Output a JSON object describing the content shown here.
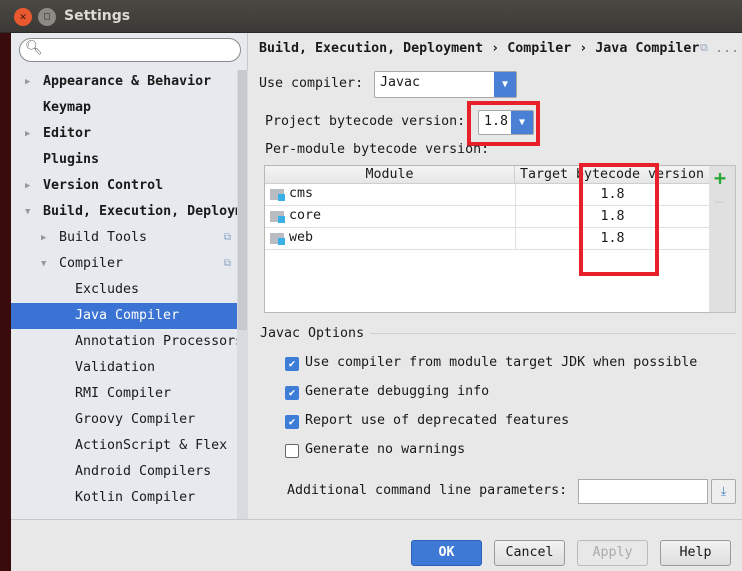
{
  "window": {
    "title": "Settings"
  },
  "search": {
    "placeholder": ""
  },
  "sidebar": {
    "items": [
      {
        "label": "Appearance & Behavior",
        "bold": true,
        "expandable": true
      },
      {
        "label": "Keymap",
        "bold": true
      },
      {
        "label": "Editor",
        "bold": true,
        "expandable": true
      },
      {
        "label": "Plugins",
        "bold": true
      },
      {
        "label": "Version Control",
        "bold": true,
        "expandable": true
      },
      {
        "label": "Build, Execution, Deployment",
        "bold": true,
        "expanded": true
      },
      {
        "label": "Build Tools",
        "expandable": true
      },
      {
        "label": "Compiler",
        "expanded": true
      },
      {
        "label": "Excludes"
      },
      {
        "label": "Java Compiler",
        "selected": true
      },
      {
        "label": "Annotation Processors"
      },
      {
        "label": "Validation"
      },
      {
        "label": "RMI Compiler"
      },
      {
        "label": "Groovy Compiler"
      },
      {
        "label": "ActionScript & Flex"
      },
      {
        "label": "Android Compilers"
      },
      {
        "label": "Kotlin Compiler"
      }
    ]
  },
  "breadcrumb": {
    "parts": [
      "Build, Execution, Deployment",
      "Compiler",
      "Java Compiler"
    ],
    "sep": "›",
    "more": "..."
  },
  "compiler": {
    "label": "Use compiler:",
    "value": "Javac"
  },
  "bytecode": {
    "label": "Project bytecode version:",
    "value": "1.8"
  },
  "per_module": {
    "label": "Per-module bytecode version:",
    "columns": [
      "Module",
      "Target bytecode version"
    ],
    "rows": [
      {
        "module": "cms",
        "version": "1.8"
      },
      {
        "module": "core",
        "version": "1.8"
      },
      {
        "module": "web",
        "version": "1.8"
      }
    ],
    "add": "+",
    "remove": "—"
  },
  "javac": {
    "title": "Javac Options",
    "options": [
      {
        "label": "Use compiler from module target JDK when possible",
        "checked": true
      },
      {
        "label": "Generate debugging info",
        "checked": true
      },
      {
        "label": "Report use of deprecated features",
        "checked": true
      },
      {
        "label": "Generate no warnings",
        "checked": false
      }
    ],
    "params_label": "Additional command line parameters:",
    "params_value": ""
  },
  "buttons": {
    "ok": "OK",
    "cancel": "Cancel",
    "apply": "Apply",
    "help": "Help"
  },
  "colors": {
    "accent": "#3a73d3",
    "highlight": "#e8202a"
  }
}
